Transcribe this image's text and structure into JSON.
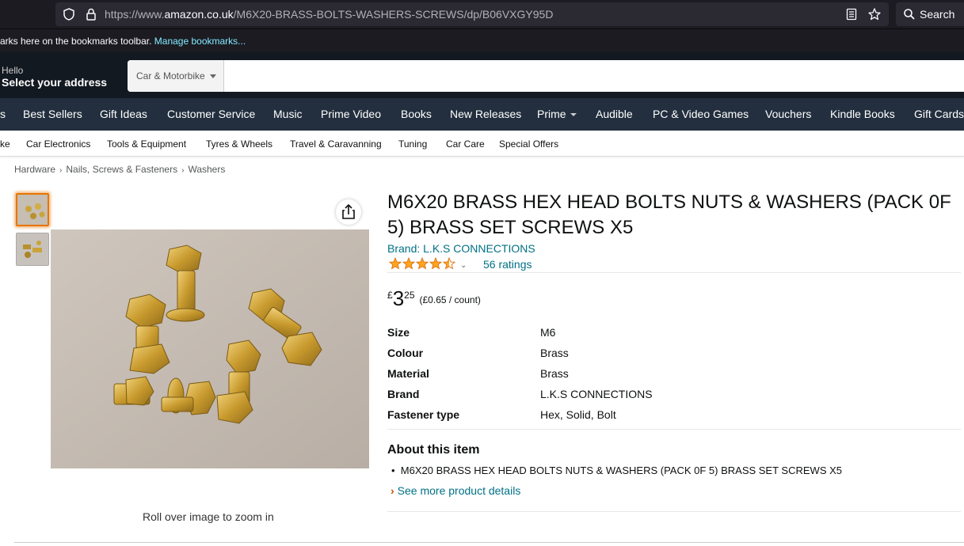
{
  "browser": {
    "url_prefix": "https://www.",
    "url_host": "amazon.co.uk",
    "url_path": "/M6X20-BRASS-BOLTS-WASHERS-SCREWS/dp/B06VXGY95D",
    "search_label": "Search",
    "bookmarks_text": "arks here on the bookmarks toolbar.",
    "bookmarks_link": "Manage bookmarks..."
  },
  "header": {
    "hello": "Hello",
    "address": "Select your address",
    "search_category": "Car & Motorbike",
    "search_value": ""
  },
  "nav_belt": [
    "s",
    "Best Sellers",
    "Gift Ideas",
    "Customer Service",
    "Music",
    "Prime Video",
    "Books",
    "New Releases",
    "Prime",
    "Audible",
    "PC & Video Games",
    "Vouchers",
    "Kindle Books",
    "Gift Cards"
  ],
  "subnav": [
    "ke",
    "Car Electronics",
    "Tools & Equipment",
    "Tyres & Wheels",
    "Travel & Caravanning",
    "Tuning",
    "Car Care",
    "Special Offers"
  ],
  "breadcrumb": [
    "Hardware",
    "Nails, Screws & Fasteners",
    "Washers"
  ],
  "gallery": {
    "rollover_text": "Roll over image to zoom in"
  },
  "product": {
    "title": "M6X20 BRASS HEX HEAD BOLTS NUTS & WASHERS (PACK 0F 5) BRASS SET SCREWS X5",
    "brand": "Brand: L.K.S CONNECTIONS",
    "rating": 4.5,
    "ratings_count": "56 ratings",
    "price_symbol": "£",
    "price_whole": "3",
    "price_fraction": "25",
    "price_per_unit": "(£0.65 / count)",
    "specs": [
      {
        "label": "Size",
        "value": "M6"
      },
      {
        "label": "Colour",
        "value": "Brass"
      },
      {
        "label": "Material",
        "value": "Brass"
      },
      {
        "label": "Brand",
        "value": "L.K.S CONNECTIONS"
      },
      {
        "label": "Fastener type",
        "value": "Hex, Solid, Bolt"
      }
    ],
    "about_heading": "About this item",
    "about_bullets": [
      "M6X20 BRASS HEX HEAD BOLTS NUTS & WASHERS (PACK 0F 5) BRASS SET SCREWS X5"
    ],
    "see_more": "See more product details"
  },
  "colors": {
    "nav_dark": "#131921",
    "nav_belt": "#232f3e",
    "link": "#007185",
    "star": "#ffa41c",
    "thumb_active": "#e77600"
  }
}
